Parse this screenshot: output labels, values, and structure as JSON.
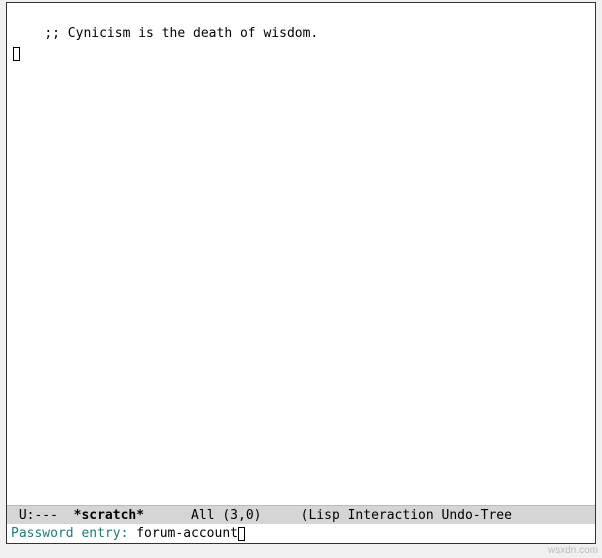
{
  "buffer": {
    "comment": ";; Cynicism is the death of wisdom."
  },
  "modeline": {
    "status": "U:---",
    "buffer_name": "*scratch*",
    "position": "All",
    "cursor": "(3,0)",
    "modes": "(Lisp Interaction Undo-Tree"
  },
  "minibuffer": {
    "prompt": "Password entry: ",
    "input": "forum-account"
  },
  "watermark": "wsxdn.com"
}
